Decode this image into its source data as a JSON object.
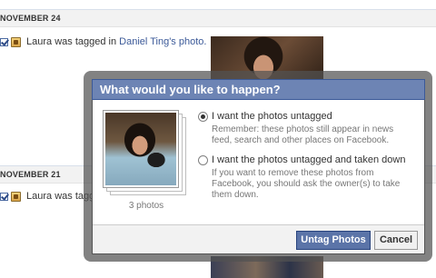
{
  "activity_log": {
    "dates": [
      "NOVEMBER 24",
      "NOVEMBER 21"
    ],
    "rows": [
      {
        "actor": "Laura",
        "action": "was tagged in",
        "owner_link": "Daniel Ting",
        "suffix": "'s photo."
      },
      {
        "actor": "Laura",
        "action": "was tagg",
        "owner_link": "",
        "suffix": ""
      }
    ]
  },
  "dialog": {
    "title": "What would you like to happen?",
    "photos_count": "3 photos",
    "options": [
      {
        "label": "I want the photos untagged",
        "help": "Remember: these photos still appear in news feed, search and other places on Facebook.",
        "checked": true
      },
      {
        "label": "I want the photos untagged and taken down",
        "help": "If you want to remove these photos from Facebook, you should ask the owner(s) to take them down.",
        "checked": false
      }
    ],
    "primary_button": "Untag Photos",
    "cancel_button": "Cancel"
  },
  "colors": {
    "title_bar": "#6d84b4",
    "link": "#3b5998",
    "primary_button": "#5b74a8"
  }
}
